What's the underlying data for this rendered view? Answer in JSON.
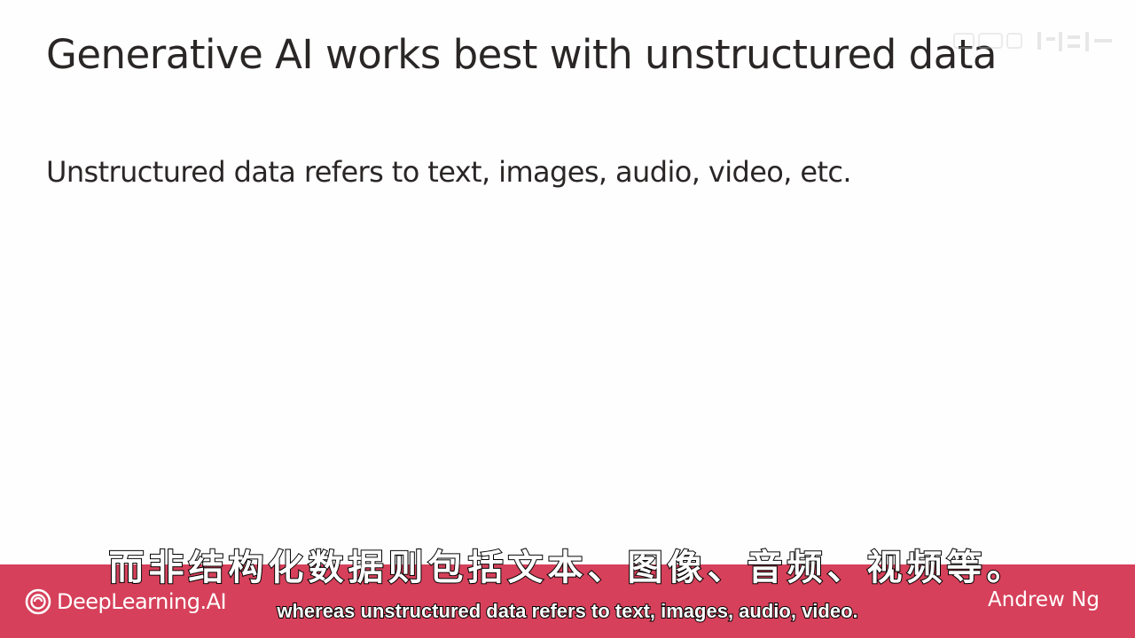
{
  "slide": {
    "title": "Generative AI works best with unstructured data",
    "subtitle": "Unstructured data refers to text, images, audio, video, etc."
  },
  "footer": {
    "logo_text": "DeepLearning.AI",
    "presenter": "Andrew Ng",
    "bar_color": "#d6405a"
  },
  "captions": {
    "chinese": "而非结构化数据则包括文本、图像、音频、视频等。",
    "english": "whereas unstructured data refers to text, images, audio, video."
  },
  "icons": {
    "logo": "deeplearning-ai-logo-icon",
    "watermark": "channel-watermark-icon"
  }
}
